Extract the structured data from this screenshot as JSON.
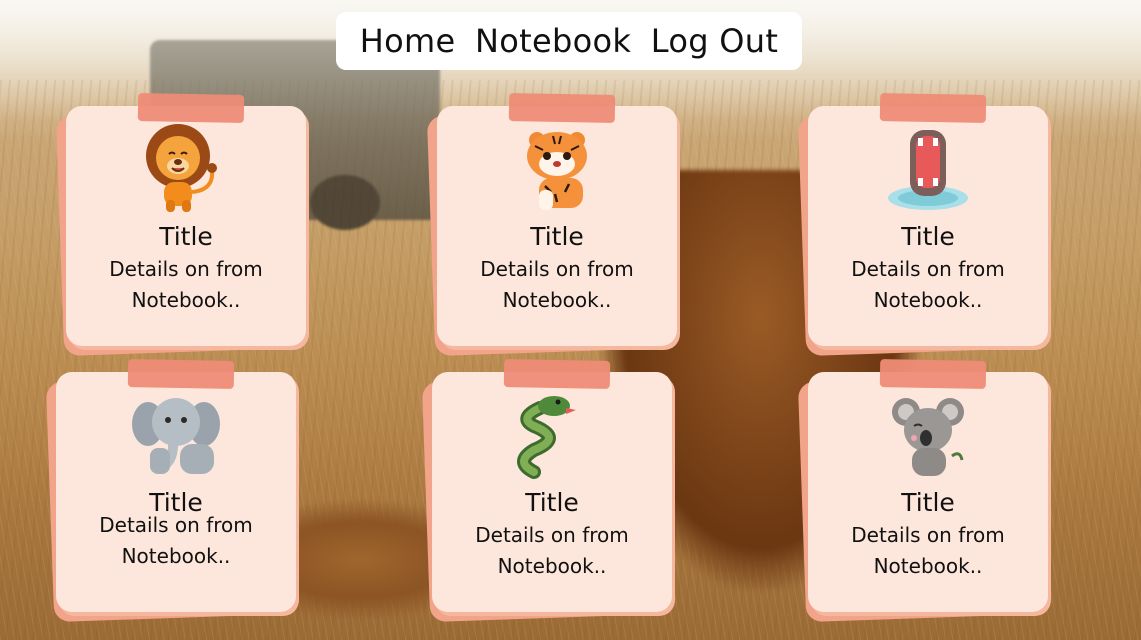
{
  "nav": {
    "items": [
      {
        "label": "Home"
      },
      {
        "label": "Notebook"
      },
      {
        "label": "Log Out"
      }
    ]
  },
  "cards": [
    {
      "title": "Title",
      "details": "Details on from Notebook..",
      "icon": "lion-icon"
    },
    {
      "title": "Title",
      "details": "Details on from Notebook..",
      "icon": "tiger-icon"
    },
    {
      "title": "Title",
      "details": "Details on from Notebook..",
      "icon": "hippo-icon"
    },
    {
      "title": "Title",
      "details": "Details on from Notebook..",
      "icon": "elephant-icon"
    },
    {
      "title": "Title",
      "details": "Details on from Notebook..",
      "icon": "snake-icon"
    },
    {
      "title": "Title",
      "details": "Details on from Notebook..",
      "icon": "koala-icon"
    }
  ],
  "colors": {
    "card_paper": "#fde7dc",
    "card_shadow": "#f2a48a",
    "tape": "#ee8c76",
    "nav_bg": "#ffffff"
  }
}
